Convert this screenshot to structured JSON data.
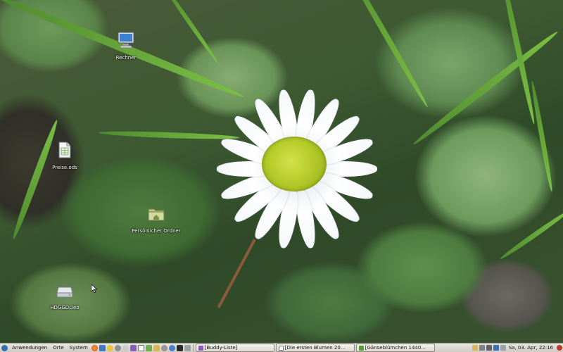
{
  "desktop": {
    "icons": [
      {
        "label": "Rechner",
        "icon": "computer-icon"
      },
      {
        "label": "Preise.ods",
        "icon": "spreadsheet-file-icon"
      },
      {
        "label": "Persönlicher Ordner",
        "icon": "home-folder-icon"
      },
      {
        "label": "HDGGDLieb",
        "icon": "drive-icon"
      }
    ]
  },
  "panel": {
    "menus": [
      "Anwendungen",
      "Orte",
      "System"
    ],
    "tasks": [
      {
        "label": "[Buddy-Liste]",
        "icon": "pidgin-icon"
      },
      {
        "label": "[Die ersten Blumen 20...",
        "icon": "document-icon"
      },
      {
        "label": "[Gänseblümchen 1440...",
        "icon": "image-viewer-icon"
      }
    ],
    "clock": "Sa, 03. Apr, 22:16"
  },
  "colors": {
    "panel_bg": "#dcd9d2",
    "accent": "#2e6fb5"
  }
}
